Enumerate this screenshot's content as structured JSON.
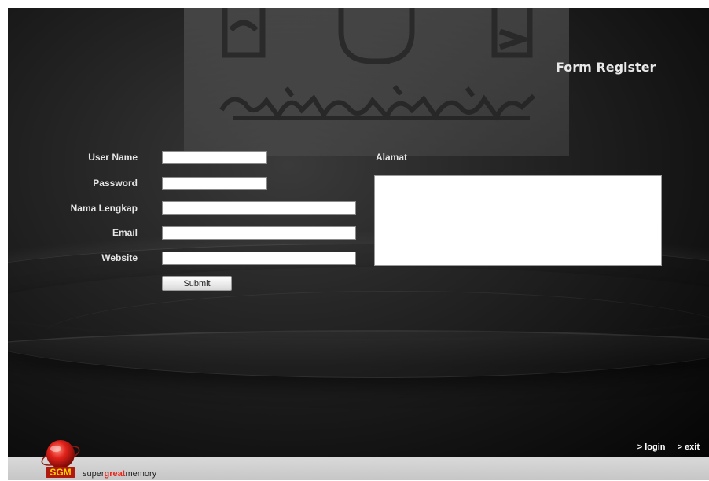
{
  "header": {
    "title": "Form Register"
  },
  "form": {
    "username": {
      "label": "User Name",
      "value": ""
    },
    "password": {
      "label": "Password",
      "value": ""
    },
    "fullname": {
      "label": "Nama Lengkap",
      "value": ""
    },
    "email": {
      "label": "Email",
      "value": ""
    },
    "website": {
      "label": "Website",
      "value": ""
    },
    "alamat": {
      "label": "Alamat",
      "value": ""
    },
    "submit_label": "Submit"
  },
  "nav": {
    "login": "> login",
    "exit": "> exit"
  },
  "footer": {
    "brand_prefix": "super",
    "brand_highlight": "great",
    "brand_suffix": "memory",
    "logo_text": "SGM"
  },
  "colors": {
    "accent": "#e8281c",
    "background": "#1a1a1a",
    "footer": "#cfcfcf"
  },
  "icons": {
    "watermark": "university-logo-watermark",
    "brand": "sgm-globe-logo"
  }
}
